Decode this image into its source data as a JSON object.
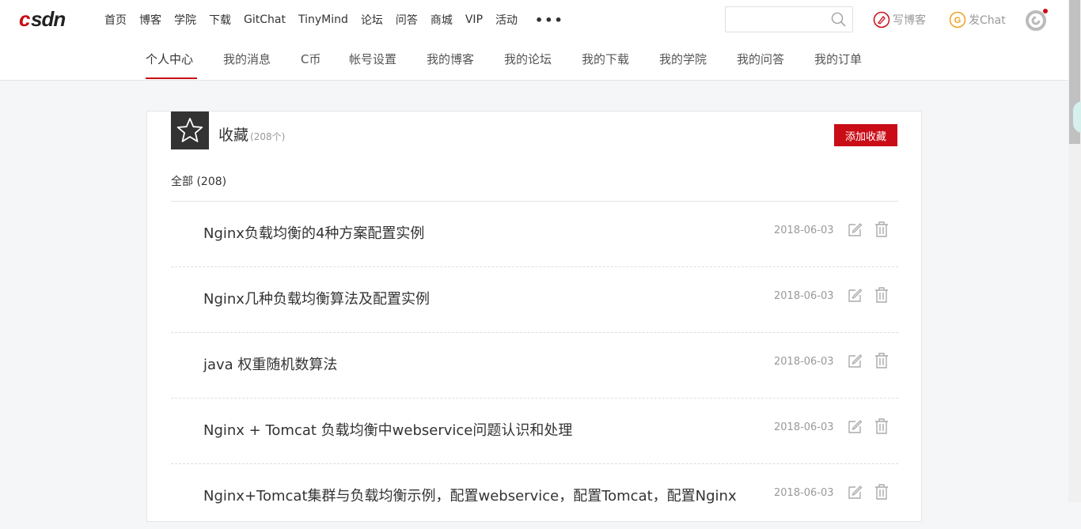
{
  "header": {
    "logo_text": "CSDN",
    "nav": [
      "首页",
      "博客",
      "学院",
      "下载",
      "GitChat",
      "TinyMind",
      "论坛",
      "问答",
      "商城",
      "VIP",
      "活动"
    ],
    "more_label": "•••",
    "search": {
      "value": "",
      "placeholder": ""
    },
    "write_blog_label": "写博客",
    "post_chat_label": "发Chat"
  },
  "subnav": {
    "tabs": [
      "个人中心",
      "我的消息",
      "C币",
      "帐号设置",
      "我的博客",
      "我的论坛",
      "我的下载",
      "我的学院",
      "我的问答",
      "我的订单"
    ],
    "active": "个人中心"
  },
  "favorites": {
    "title": "收藏",
    "count_text": "(208个)",
    "add_button": "添加收藏",
    "filter_label": "全部 (208)",
    "items": [
      {
        "title": "Nginx负载均衡的4种方案配置实例",
        "date": "2018-06-03"
      },
      {
        "title": "Nginx几种负载均衡算法及配置实例",
        "date": "2018-06-03"
      },
      {
        "title": "java 权重随机数算法",
        "date": "2018-06-03"
      },
      {
        "title": "Nginx + Tomcat 负载均衡中webservice问题认识和处理",
        "date": "2018-06-03"
      },
      {
        "title": "Nginx+Tomcat集群与负载均衡示例，配置webservice，配置Tomcat，配置Nginx",
        "date": "2018-06-03"
      }
    ]
  },
  "colors": {
    "brand_red": "#ca0c16",
    "chat_orange": "#f0a020"
  }
}
